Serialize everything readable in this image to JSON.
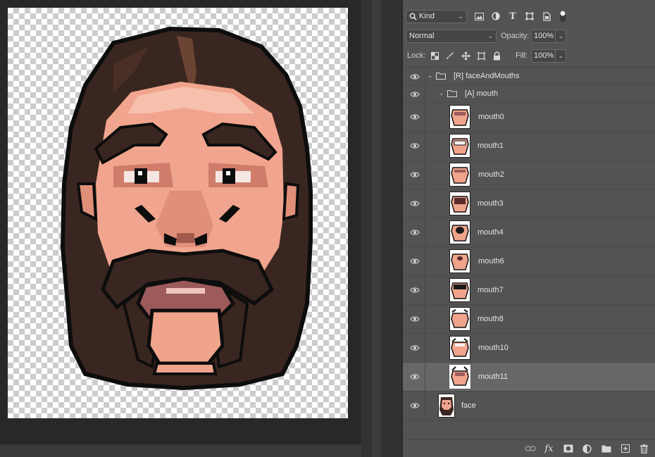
{
  "canvas": {
    "document": "pixel-art-face"
  },
  "filter_bar": {
    "kind_label": "Kind",
    "icons": [
      "image-filter-icon",
      "adjustment-filter-icon",
      "type-filter-icon",
      "shape-filter-icon",
      "smart-object-filter-icon",
      "filter-toggle-icon"
    ]
  },
  "blend": {
    "mode": "Normal",
    "opacity_label": "Opacity:",
    "opacity_value": "100%"
  },
  "lock": {
    "label": "Lock:",
    "icons": [
      "lock-transparent-icon",
      "lock-image-icon",
      "lock-position-icon",
      "lock-artboard-icon",
      "lock-all-icon"
    ],
    "fill_label": "Fill:",
    "fill_value": "100%"
  },
  "layers": {
    "group_root": "[R] faceAndMouths",
    "group_mouth": "[A] mouth",
    "items": [
      {
        "name": "mouth0"
      },
      {
        "name": "mouth1"
      },
      {
        "name": "mouth2"
      },
      {
        "name": "mouth3"
      },
      {
        "name": "mouth4"
      },
      {
        "name": "mouth6"
      },
      {
        "name": "mouth7"
      },
      {
        "name": "mouth8"
      },
      {
        "name": "mouth10"
      },
      {
        "name": "mouth11",
        "selected": true
      }
    ],
    "face": "face"
  },
  "footer": {
    "icons": [
      "link-layers-icon",
      "fx-icon",
      "add-mask-icon",
      "adjustment-layer-icon",
      "new-group-icon",
      "new-layer-icon",
      "delete-icon"
    ],
    "fx_label": "fx"
  },
  "colors": {
    "panel_bg": "#535353",
    "selected_row": "#676767",
    "canvas_bg": "#282828"
  }
}
